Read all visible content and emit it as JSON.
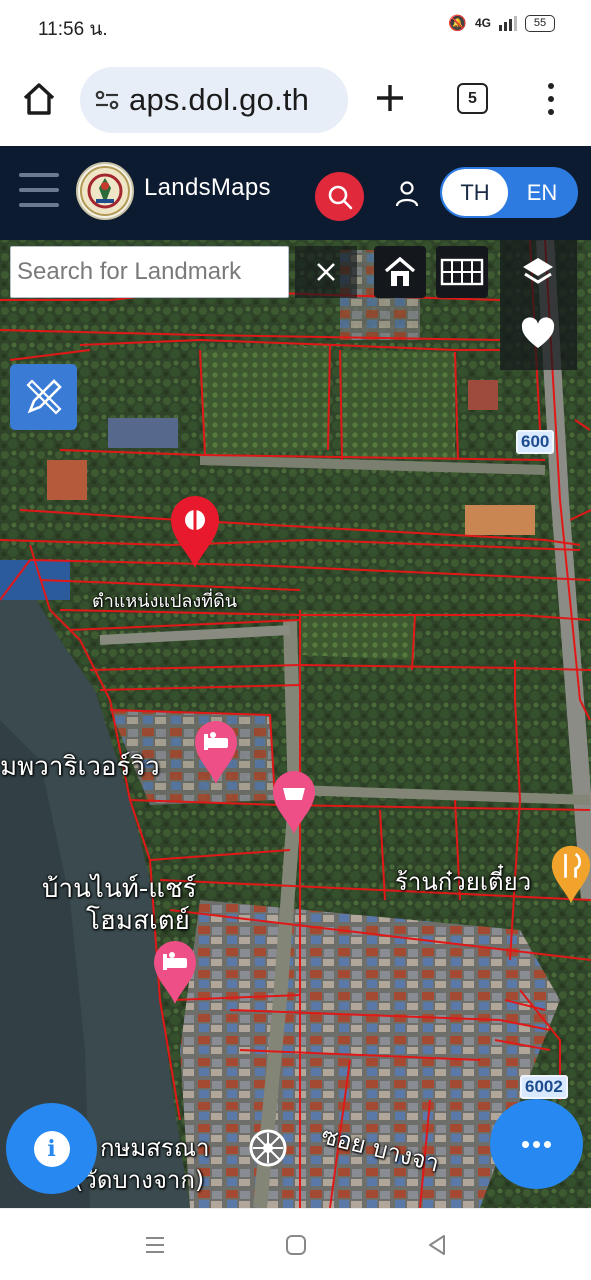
{
  "status_bar": {
    "time": "11:56 น.",
    "network": "4G",
    "battery": "55"
  },
  "browser": {
    "url": "aps.dol.go.th",
    "tab_count": "5",
    "icons": [
      "home-icon",
      "site-settings-icon",
      "new-tab-icon",
      "tab-switcher-icon",
      "more-vert-icon"
    ]
  },
  "app_header": {
    "brand": "LandsMaps",
    "lang": {
      "th": "TH",
      "en": "EN",
      "active": "TH"
    },
    "colors": {
      "header_bg": "#0d1b30",
      "search_red": "#e0293a",
      "toggle_blue": "#2d7be0"
    }
  },
  "map": {
    "search": {
      "placeholder": "Search for Landmark",
      "value": ""
    },
    "tools": [
      "home-extent-icon",
      "grid-icon",
      "layers-icon",
      "favorite-heart-icon",
      "draw-measure-icon"
    ],
    "labels": {
      "parcel_pin_label": "ตำแหน่งแปลงที่ดิน",
      "resort": "มพวาริเวอร์วิว",
      "homestay_line1": "บ้านไนท์-แชร์",
      "homestay_line2": "โฮมสเตย์",
      "noodle_shop": "ร้านก๋วยเตี๋ยว",
      "soi": "ซอย บางจา",
      "temple_line1": "กษมสรณา",
      "temple_line2": "(วัดบางจาก)"
    },
    "road_badges": [
      "600",
      "6002"
    ],
    "colors": {
      "parcel_lines": "#e01818",
      "pin_red": "#e8192c",
      "fab_blue": "#2688f0",
      "tool_blue": "#3a7bd5"
    }
  },
  "nav_bar": {
    "icons": [
      "recents-icon",
      "home-circle-icon",
      "back-icon"
    ]
  }
}
